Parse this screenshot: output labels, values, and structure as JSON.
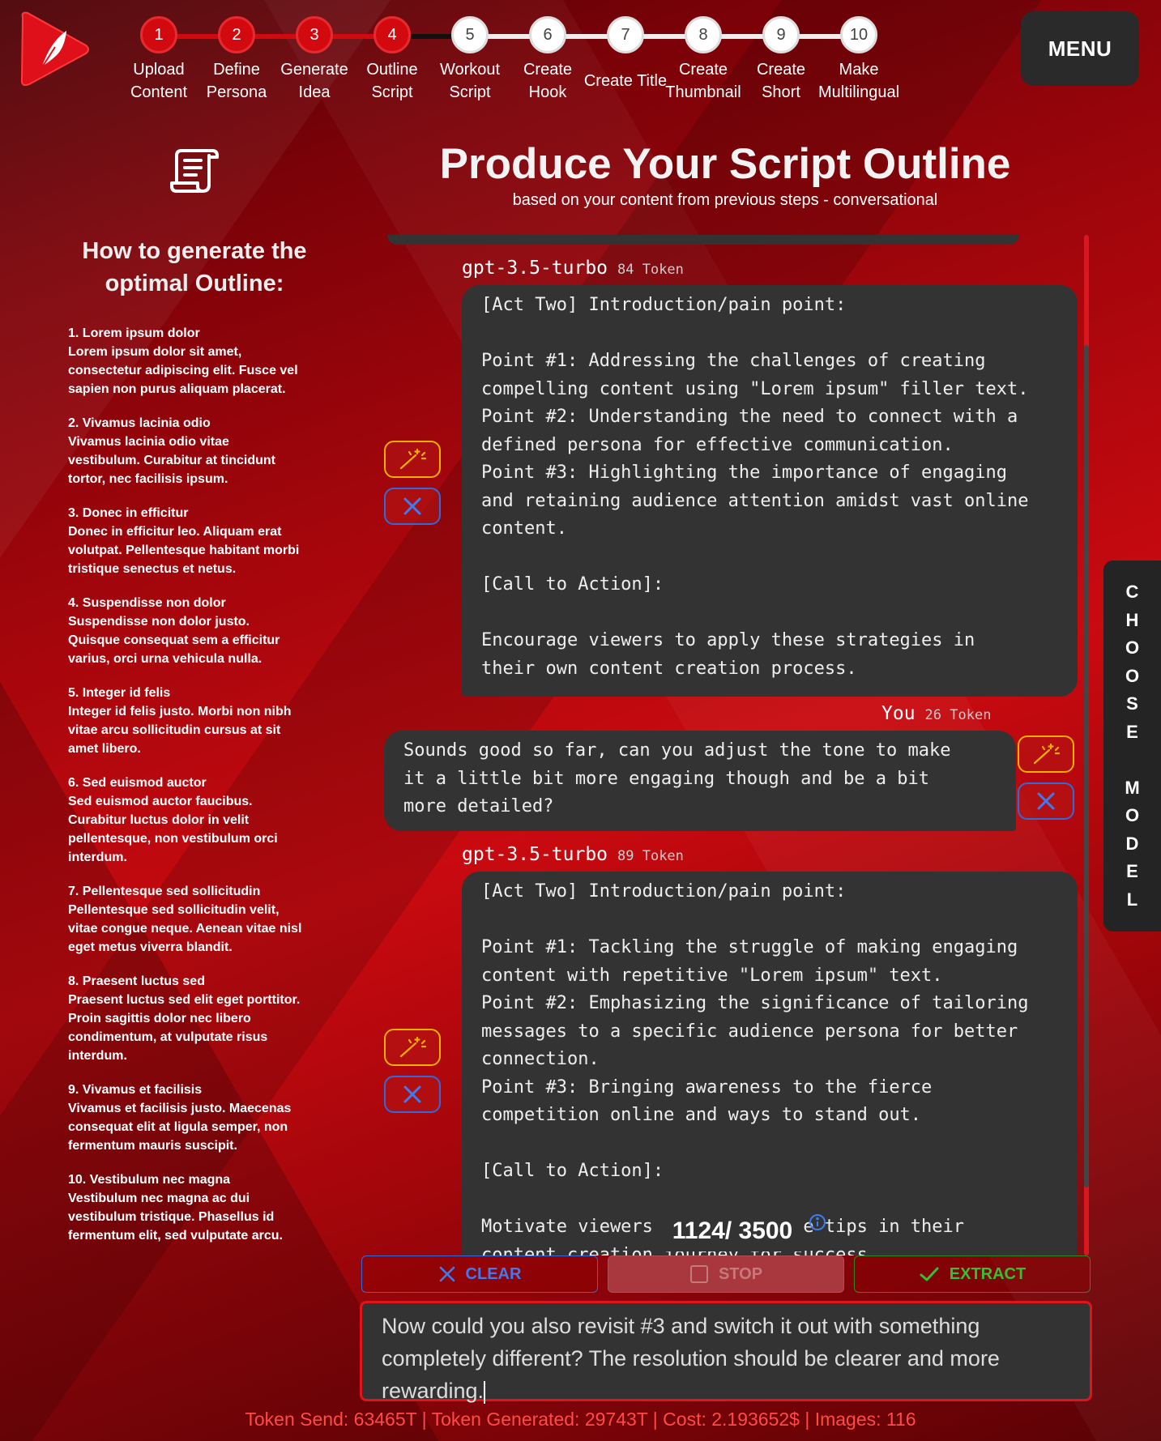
{
  "header": {
    "menu_label": "MENU",
    "steps": [
      {
        "num": "1",
        "line1": "Upload",
        "line2": "Content",
        "state": "done"
      },
      {
        "num": "2",
        "line1": "Define",
        "line2": "Persona",
        "state": "done"
      },
      {
        "num": "3",
        "line1": "Generate",
        "line2": "Idea",
        "state": "done"
      },
      {
        "num": "4",
        "line1": "Outline",
        "line2": "Script",
        "state": "done"
      },
      {
        "num": "5",
        "line1": "Workout",
        "line2": "Script",
        "state": "todo"
      },
      {
        "num": "6",
        "line1": "Create",
        "line2": "Hook",
        "state": "todo"
      },
      {
        "num": "7",
        "line1": "Create Title",
        "line2": "",
        "state": "todo"
      },
      {
        "num": "8",
        "line1": "Create",
        "line2": "Thumbnail",
        "state": "todo"
      },
      {
        "num": "9",
        "line1": "Create",
        "line2": "Short",
        "state": "todo"
      },
      {
        "num": "10",
        "line1": "Make",
        "line2": "Multilingual",
        "state": "todo"
      }
    ]
  },
  "sidebar": {
    "title": "How to generate the optimal Outline:",
    "tips": [
      {
        "heading": "1. Lorem ipsum dolor",
        "body": "Lorem ipsum dolor sit amet, consectetur adipiscing elit. Fusce vel sapien non purus aliquam placerat."
      },
      {
        "heading": "2. Vivamus lacinia odio",
        "body": "Vivamus lacinia odio vitae vestibulum. Curabitur at tincidunt tortor, nec facilisis ipsum."
      },
      {
        "heading": "3. Donec in efficitur",
        "body": "Donec in efficitur leo. Aliquam erat volutpat. Pellentesque habitant morbi tristique senectus et netus."
      },
      {
        "heading": "4. Suspendisse non dolor",
        "body": "Suspendisse non dolor justo. Quisque consequat sem a efficitur varius, orci urna vehicula nulla."
      },
      {
        "heading": "5. Integer id felis",
        "body": "Integer id felis justo. Morbi non nibh vitae arcu sollicitudin cursus at sit amet libero."
      },
      {
        "heading": "6. Sed euismod auctor",
        "body": "Sed euismod auctor faucibus. Curabitur luctus dolor in velit pellentesque, non vestibulum orci interdum."
      },
      {
        "heading": "7. Pellentesque sed sollicitudin",
        "body": "Pellentesque sed sollicitudin velit, vitae congue neque. Aenean vitae nisl eget metus viverra blandit."
      },
      {
        "heading": "8. Praesent luctus sed",
        "body": "Praesent luctus sed elit eget porttitor. Proin sagittis dolor nec libero condimentum, at vulputate risus interdum."
      },
      {
        "heading": "9. Vivamus et facilisis",
        "body": "Vivamus et facilisis justo. Maecenas consequat elit at ligula semper, non fermentum mauris suscipit."
      },
      {
        "heading": "10. Vestibulum nec magna",
        "body": "Vestibulum nec magna ac dui vestibulum tristique. Phasellus id fermentum elit, sed vulputate arcu."
      }
    ]
  },
  "main": {
    "title": "Produce Your Script Outline",
    "subtitle": "based on your content from previous steps - conversational"
  },
  "chat": {
    "messages": [
      {
        "sender": "gpt-3.5-turbo",
        "tokens": "84 Token",
        "text": "[Act Two] Introduction/pain point:\n\nPoint #1: Addressing the challenges of creating\ncompelling content using \"Lorem ipsum\" filler text.\nPoint #2: Understanding the need to connect with a\ndefined persona for effective communication.\nPoint #3: Highlighting the importance of engaging\nand retaining audience attention amidst vast online\ncontent.\n\n[Call to Action]:\n\nEncourage viewers to apply these strategies in\ntheir own content creation process."
      },
      {
        "sender": "You",
        "tokens": "26 Token",
        "text": "Sounds good so far, can you adjust the tone to make\nit a little bit more engaging though and be a bit\nmore detailed?"
      },
      {
        "sender": "gpt-3.5-turbo",
        "tokens": "89 Token",
        "text": "[Act Two] Introduction/pain point:\n\nPoint #1: Tackling the struggle of making engaging\ncontent with repetitive \"Lorem ipsum\" text.\nPoint #2: Emphasizing the significance of tailoring\nmessages to a specific audience persona for better\nconnection.\nPoint #3: Bringing awareness to the fierce\ncompetition online and ways to stand out.\n\n[Call to Action]:\n\nMotivate viewers to apply these tips in their\ncontent creation journey for success."
      }
    ],
    "counter": "1124/ 3500"
  },
  "model_tab": {
    "letters": [
      "C",
      "H",
      "O",
      "O",
      "S",
      "E",
      "",
      "M",
      "O",
      "D",
      "E",
      "L"
    ]
  },
  "actions": {
    "clear": "CLEAR",
    "stop": "STOP",
    "extract": "EXTRACT"
  },
  "input": {
    "value": "Now could you also revisit #3 and switch it out with something completely different? The resolution should be clearer and more rewarding."
  },
  "footer": {
    "stats": "Token Send: 63465T  | Token  Generated: 29743T  |  Cost: 2.193652$  | Images: 116"
  },
  "colors": {
    "accent": "#d20a0f",
    "bubble": "#333333",
    "wand": "#f4b000",
    "delete": "#2f6bdc",
    "extract": "#33c133"
  },
  "icons": [
    "logo-icon",
    "script-scroll-icon",
    "magic-wand-icon",
    "close-icon",
    "checkbox-icon",
    "check-icon",
    "info-icon"
  ]
}
